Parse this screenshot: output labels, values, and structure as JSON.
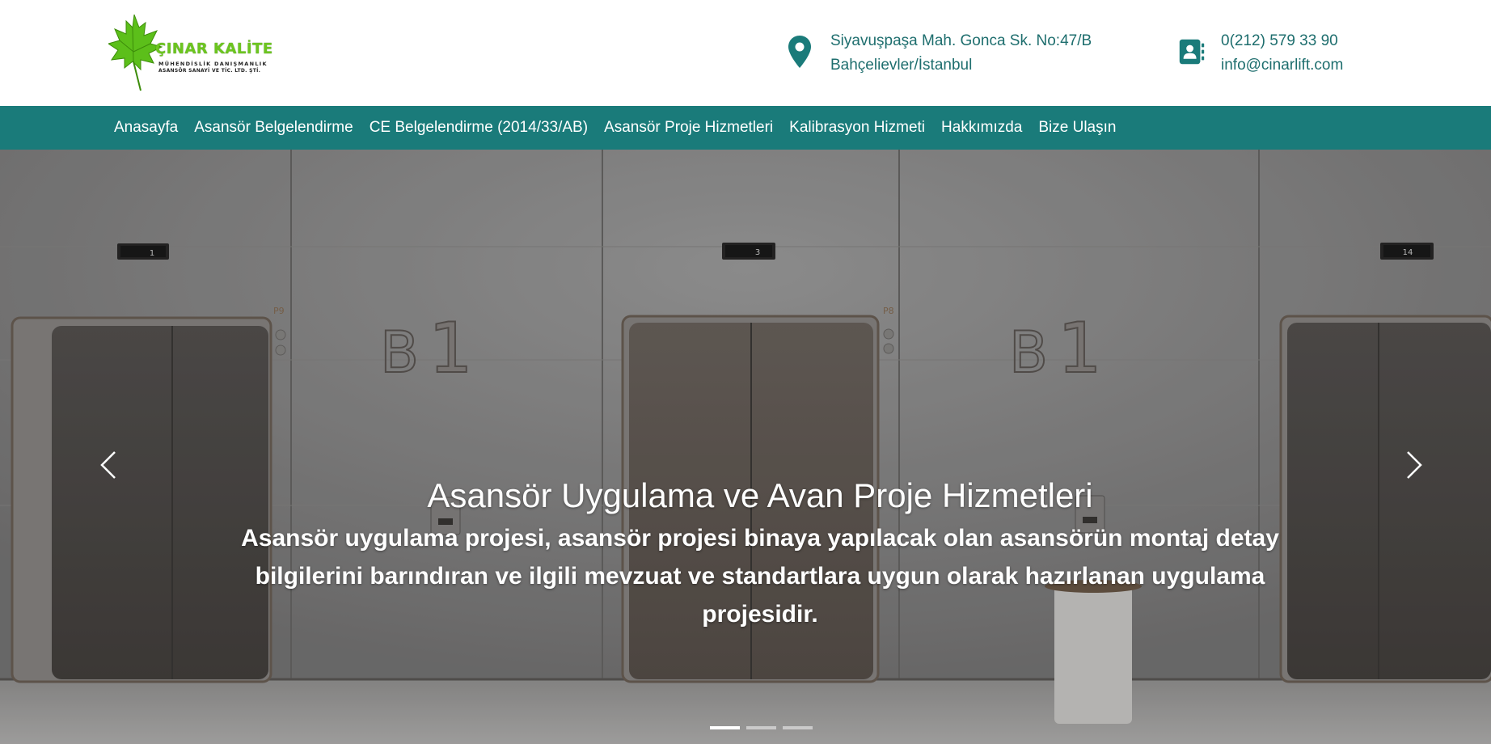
{
  "logo": {
    "title": "ÇINAR KALİTE",
    "subtitle1": "MÜHENDİSLİK DANIŞMANLIK",
    "subtitle2": "ASANSÖR SANAYİ VE TİC. LTD. ŞTİ.",
    "brand_color": "#6cc51f"
  },
  "contact": {
    "address_icon": "map-marker-icon",
    "address_line1": "Siyavuşpaşa Mah. Gonca Sk. No:47/B",
    "address_line2": "Bahçelievler/İstanbul",
    "phone_icon": "contact-book-icon",
    "phone": "0(212) 579 33 90",
    "email": "info@cinarlift.com",
    "text_color": "#1e6e6e"
  },
  "nav": {
    "background": "#1a7b7a",
    "items": [
      {
        "label": "Anasayfa"
      },
      {
        "label": "Asansör Belgelendirme"
      },
      {
        "label": "CE Belgelendirme (2014/33/AB)"
      },
      {
        "label": "Asansör Proje Hizmetleri"
      },
      {
        "label": "Kalibrasyon Hizmeti"
      },
      {
        "label": "Hakkımızda"
      },
      {
        "label": "Bize Ulaşın"
      }
    ]
  },
  "hero": {
    "image_alt": "elevator lobby",
    "floor_displays": [
      "1",
      "3",
      "14"
    ],
    "floor_labels": [
      "P9",
      "P8"
    ],
    "wall_signs": [
      "B1",
      "B1"
    ],
    "title": "Asansör Uygulama ve Avan Proje Hizmetleri",
    "text": "Asansör uygulama projesi, asansör projesi binaya yapılacak olan asansörün montaj detay bilgilerini barındıran ve ilgili mevzuat ve standartlara uygun olarak hazırlanan uygulama projesidir.",
    "prev_icon": "chevron-left-icon",
    "next_icon": "chevron-right-icon",
    "slides": 3,
    "active_slide": 1
  }
}
